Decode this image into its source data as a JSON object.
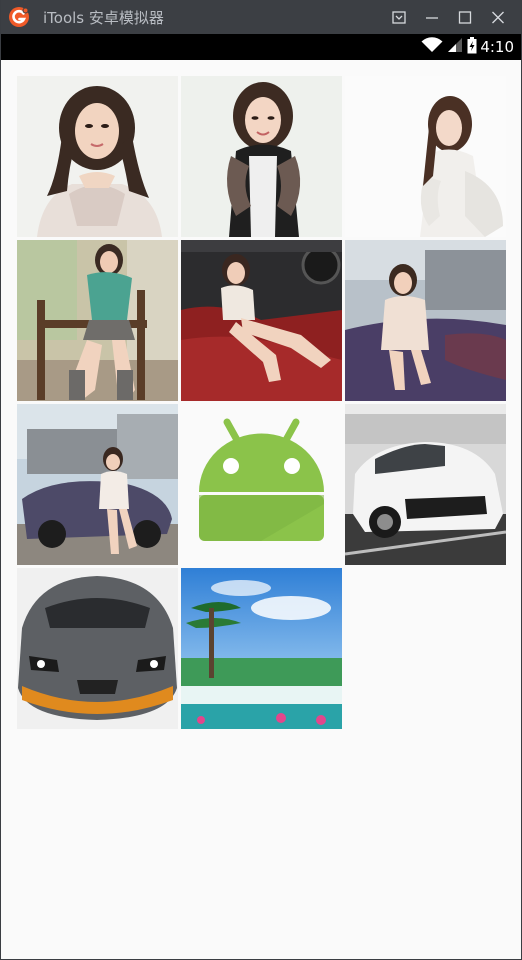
{
  "window": {
    "title": "iTools 安卓模拟器",
    "logo_icon": "itools-logo-icon",
    "buttons": [
      "screenshot-icon",
      "minimize-icon",
      "maximize-icon",
      "close-icon"
    ]
  },
  "statusbar": {
    "time": "4:10",
    "icons": [
      "wifi-icon",
      "signal-icon",
      "battery-charging-icon"
    ]
  },
  "gallery": {
    "columns": 3,
    "images": [
      {
        "name": "photo-woman-lace-top",
        "kind": "portrait-light"
      },
      {
        "name": "photo-woman-lace-sleeves",
        "kind": "portrait-light"
      },
      {
        "name": "photo-woman-white-sweater",
        "kind": "portrait-white"
      },
      {
        "name": "photo-woman-chair",
        "kind": "indoor-chair"
      },
      {
        "name": "photo-woman-red-car-interior",
        "kind": "car-interior"
      },
      {
        "name": "photo-woman-on-car-hood",
        "kind": "car-hood"
      },
      {
        "name": "photo-woman-purple-car",
        "kind": "street-car"
      },
      {
        "name": "android-placeholder",
        "kind": "placeholder"
      },
      {
        "name": "photo-white-sports-car",
        "kind": "white-car"
      },
      {
        "name": "photo-gray-lamborghini",
        "kind": "gray-car"
      },
      {
        "name": "photo-waterfall-landscape",
        "kind": "landscape"
      }
    ]
  },
  "colors": {
    "titlebar": "#3c3f44",
    "statusbar": "#000000",
    "background": "#fafafa",
    "android_green": "#8bc34a",
    "logo_orange": "#f05a28"
  }
}
